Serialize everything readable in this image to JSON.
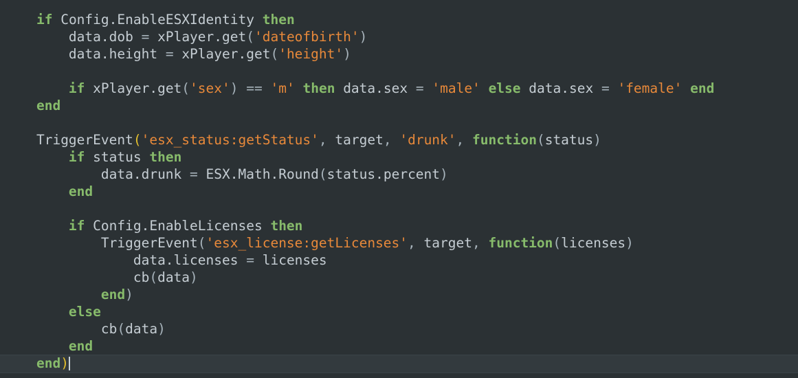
{
  "editor": {
    "language": "lua",
    "background_color": "#2b3134",
    "active_line_color": "#333a3e",
    "colors": {
      "keyword": "#87bb6b",
      "identifier": "#c5cdd3",
      "operator": "#a7b3bb",
      "string": "#e8893a",
      "bracket_gold": "#e5c02e",
      "bracket_plain": "#a7b3bb",
      "caret": "#c9d2d8"
    },
    "cursor": {
      "line_index": 18,
      "after_text": "end)"
    },
    "lines": [
      {
        "index": 0,
        "text": "    if Config.EnableESXIdentity then",
        "tokens": [
          {
            "t": "    ",
            "c": "plain"
          },
          {
            "t": "if",
            "c": "kw"
          },
          {
            "t": " ",
            "c": "plain"
          },
          {
            "t": "Config.EnableESXIdentity",
            "c": "plain"
          },
          {
            "t": " ",
            "c": "plain"
          },
          {
            "t": "then",
            "c": "kw"
          }
        ]
      },
      {
        "index": 1,
        "text": "        data.dob = xPlayer.get('dateofbirth')",
        "tokens": [
          {
            "t": "        ",
            "c": "plain"
          },
          {
            "t": "data.dob",
            "c": "plain"
          },
          {
            "t": " ",
            "c": "plain"
          },
          {
            "t": "=",
            "c": "op"
          },
          {
            "t": " ",
            "c": "plain"
          },
          {
            "t": "xPlayer.get",
            "c": "plain"
          },
          {
            "t": "(",
            "c": "paren"
          },
          {
            "t": "'dateofbirth'",
            "c": "str"
          },
          {
            "t": ")",
            "c": "paren"
          }
        ]
      },
      {
        "index": 2,
        "text": "        data.height = xPlayer.get('height')",
        "tokens": [
          {
            "t": "        ",
            "c": "plain"
          },
          {
            "t": "data.height",
            "c": "plain"
          },
          {
            "t": " ",
            "c": "plain"
          },
          {
            "t": "=",
            "c": "op"
          },
          {
            "t": " ",
            "c": "plain"
          },
          {
            "t": "xPlayer.get",
            "c": "plain"
          },
          {
            "t": "(",
            "c": "paren"
          },
          {
            "t": "'height'",
            "c": "str"
          },
          {
            "t": ")",
            "c": "paren"
          }
        ]
      },
      {
        "index": 3,
        "text": "",
        "tokens": []
      },
      {
        "index": 4,
        "text": "        if xPlayer.get('sex') == 'm' then data.sex = 'male' else data.sex = 'female' end",
        "tokens": [
          {
            "t": "        ",
            "c": "plain"
          },
          {
            "t": "if",
            "c": "kw"
          },
          {
            "t": " ",
            "c": "plain"
          },
          {
            "t": "xPlayer.get",
            "c": "plain"
          },
          {
            "t": "(",
            "c": "paren"
          },
          {
            "t": "'sex'",
            "c": "str"
          },
          {
            "t": ")",
            "c": "paren"
          },
          {
            "t": " ",
            "c": "plain"
          },
          {
            "t": "==",
            "c": "op"
          },
          {
            "t": " ",
            "c": "plain"
          },
          {
            "t": "'m'",
            "c": "str"
          },
          {
            "t": " ",
            "c": "plain"
          },
          {
            "t": "then",
            "c": "kw"
          },
          {
            "t": " ",
            "c": "plain"
          },
          {
            "t": "data.sex",
            "c": "plain"
          },
          {
            "t": " ",
            "c": "plain"
          },
          {
            "t": "=",
            "c": "op"
          },
          {
            "t": " ",
            "c": "plain"
          },
          {
            "t": "'male'",
            "c": "str"
          },
          {
            "t": " ",
            "c": "plain"
          },
          {
            "t": "else",
            "c": "kw"
          },
          {
            "t": " ",
            "c": "plain"
          },
          {
            "t": "data.sex",
            "c": "plain"
          },
          {
            "t": " ",
            "c": "plain"
          },
          {
            "t": "=",
            "c": "op"
          },
          {
            "t": " ",
            "c": "plain"
          },
          {
            "t": "'female'",
            "c": "str"
          },
          {
            "t": " ",
            "c": "plain"
          },
          {
            "t": "end",
            "c": "kw"
          }
        ]
      },
      {
        "index": 5,
        "text": "    end",
        "tokens": [
          {
            "t": "    ",
            "c": "plain"
          },
          {
            "t": "end",
            "c": "kw"
          }
        ]
      },
      {
        "index": 6,
        "text": "",
        "tokens": []
      },
      {
        "index": 7,
        "text": "    TriggerEvent('esx_status:getStatus', target, 'drunk', function(status)",
        "tokens": [
          {
            "t": "    ",
            "c": "plain"
          },
          {
            "t": "TriggerEvent",
            "c": "plain"
          },
          {
            "t": "(",
            "c": "paren-gold"
          },
          {
            "t": "'esx_status:getStatus'",
            "c": "str"
          },
          {
            "t": ",",
            "c": "op"
          },
          {
            "t": " ",
            "c": "plain"
          },
          {
            "t": "target",
            "c": "plain"
          },
          {
            "t": ",",
            "c": "op"
          },
          {
            "t": " ",
            "c": "plain"
          },
          {
            "t": "'drunk'",
            "c": "str"
          },
          {
            "t": ",",
            "c": "op"
          },
          {
            "t": " ",
            "c": "plain"
          },
          {
            "t": "function",
            "c": "kw"
          },
          {
            "t": "(",
            "c": "paren"
          },
          {
            "t": "status",
            "c": "plain"
          },
          {
            "t": ")",
            "c": "paren"
          }
        ]
      },
      {
        "index": 8,
        "text": "        if status then",
        "tokens": [
          {
            "t": "        ",
            "c": "plain"
          },
          {
            "t": "if",
            "c": "kw"
          },
          {
            "t": " ",
            "c": "plain"
          },
          {
            "t": "status",
            "c": "plain"
          },
          {
            "t": " ",
            "c": "plain"
          },
          {
            "t": "then",
            "c": "kw"
          }
        ]
      },
      {
        "index": 9,
        "text": "            data.drunk = ESX.Math.Round(status.percent)",
        "tokens": [
          {
            "t": "            ",
            "c": "plain"
          },
          {
            "t": "data.drunk",
            "c": "plain"
          },
          {
            "t": " ",
            "c": "plain"
          },
          {
            "t": "=",
            "c": "op"
          },
          {
            "t": " ",
            "c": "plain"
          },
          {
            "t": "ESX.Math.Round",
            "c": "plain"
          },
          {
            "t": "(",
            "c": "paren"
          },
          {
            "t": "status.percent",
            "c": "plain"
          },
          {
            "t": ")",
            "c": "paren"
          }
        ]
      },
      {
        "index": 10,
        "text": "        end",
        "tokens": [
          {
            "t": "        ",
            "c": "plain"
          },
          {
            "t": "end",
            "c": "kw"
          }
        ]
      },
      {
        "index": 11,
        "text": "",
        "tokens": []
      },
      {
        "index": 12,
        "text": "        if Config.EnableLicenses then",
        "tokens": [
          {
            "t": "        ",
            "c": "plain"
          },
          {
            "t": "if",
            "c": "kw"
          },
          {
            "t": " ",
            "c": "plain"
          },
          {
            "t": "Config.EnableLicenses",
            "c": "plain"
          },
          {
            "t": " ",
            "c": "plain"
          },
          {
            "t": "then",
            "c": "kw"
          }
        ]
      },
      {
        "index": 13,
        "text": "            TriggerEvent('esx_license:getLicenses', target, function(licenses)",
        "tokens": [
          {
            "t": "            ",
            "c": "plain"
          },
          {
            "t": "TriggerEvent",
            "c": "plain"
          },
          {
            "t": "(",
            "c": "paren"
          },
          {
            "t": "'esx_license:getLicenses'",
            "c": "str"
          },
          {
            "t": ",",
            "c": "op"
          },
          {
            "t": " ",
            "c": "plain"
          },
          {
            "t": "target",
            "c": "plain"
          },
          {
            "t": ",",
            "c": "op"
          },
          {
            "t": " ",
            "c": "plain"
          },
          {
            "t": "function",
            "c": "kw"
          },
          {
            "t": "(",
            "c": "paren"
          },
          {
            "t": "licenses",
            "c": "plain"
          },
          {
            "t": ")",
            "c": "paren"
          }
        ]
      },
      {
        "index": 14,
        "text": "                data.licenses = licenses",
        "tokens": [
          {
            "t": "                ",
            "c": "plain"
          },
          {
            "t": "data.licenses",
            "c": "plain"
          },
          {
            "t": " ",
            "c": "plain"
          },
          {
            "t": "=",
            "c": "op"
          },
          {
            "t": " ",
            "c": "plain"
          },
          {
            "t": "licenses",
            "c": "plain"
          }
        ]
      },
      {
        "index": 15,
        "text": "                cb(data)",
        "tokens": [
          {
            "t": "                ",
            "c": "plain"
          },
          {
            "t": "cb",
            "c": "plain"
          },
          {
            "t": "(",
            "c": "paren"
          },
          {
            "t": "data",
            "c": "plain"
          },
          {
            "t": ")",
            "c": "paren"
          }
        ]
      },
      {
        "index": 16,
        "text": "            end)",
        "tokens": [
          {
            "t": "            ",
            "c": "plain"
          },
          {
            "t": "end",
            "c": "kw"
          },
          {
            "t": ")",
            "c": "paren"
          }
        ]
      },
      {
        "index": 17,
        "text": "        else",
        "tokens": [
          {
            "t": "        ",
            "c": "plain"
          },
          {
            "t": "else",
            "c": "kw"
          }
        ]
      },
      {
        "index": 18,
        "text": "            cb(data)",
        "tokens": [
          {
            "t": "            ",
            "c": "plain"
          },
          {
            "t": "cb",
            "c": "plain"
          },
          {
            "t": "(",
            "c": "paren"
          },
          {
            "t": "data",
            "c": "plain"
          },
          {
            "t": ")",
            "c": "paren"
          }
        ]
      },
      {
        "index": 19,
        "text": "        end",
        "tokens": [
          {
            "t": "        ",
            "c": "plain"
          },
          {
            "t": "end",
            "c": "kw"
          }
        ]
      },
      {
        "index": 20,
        "text": "    end)",
        "active": true,
        "cursor": true,
        "tokens": [
          {
            "t": "    ",
            "c": "plain"
          },
          {
            "t": "end",
            "c": "kw"
          },
          {
            "t": ")",
            "c": "paren-gold"
          }
        ]
      }
    ]
  }
}
